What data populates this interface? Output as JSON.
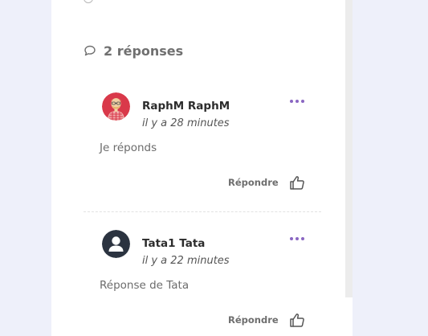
{
  "replies_header": {
    "title": "2 réponses"
  },
  "replies": [
    {
      "author": "RaphM RaphM",
      "time": "il y a 28 minutes",
      "text": "Je réponds",
      "reply_label": "Répondre"
    },
    {
      "author": "Tata1 Tata",
      "time": "il y a 22 minutes",
      "text": "Réponse de Tata",
      "reply_label": "Répondre"
    }
  ],
  "colors": {
    "page_background": "#eef0fa",
    "panel_background": "#ffffff",
    "accent": "#8a67c2",
    "avatar_red": "#d9394a",
    "avatar_dark": "#2b3340"
  },
  "icons": {
    "replies_header": "comment-bubble-icon",
    "more": "more-dots-icon",
    "like": "thumbs-up-icon",
    "avatar_default": "user-silhouette-icon"
  }
}
